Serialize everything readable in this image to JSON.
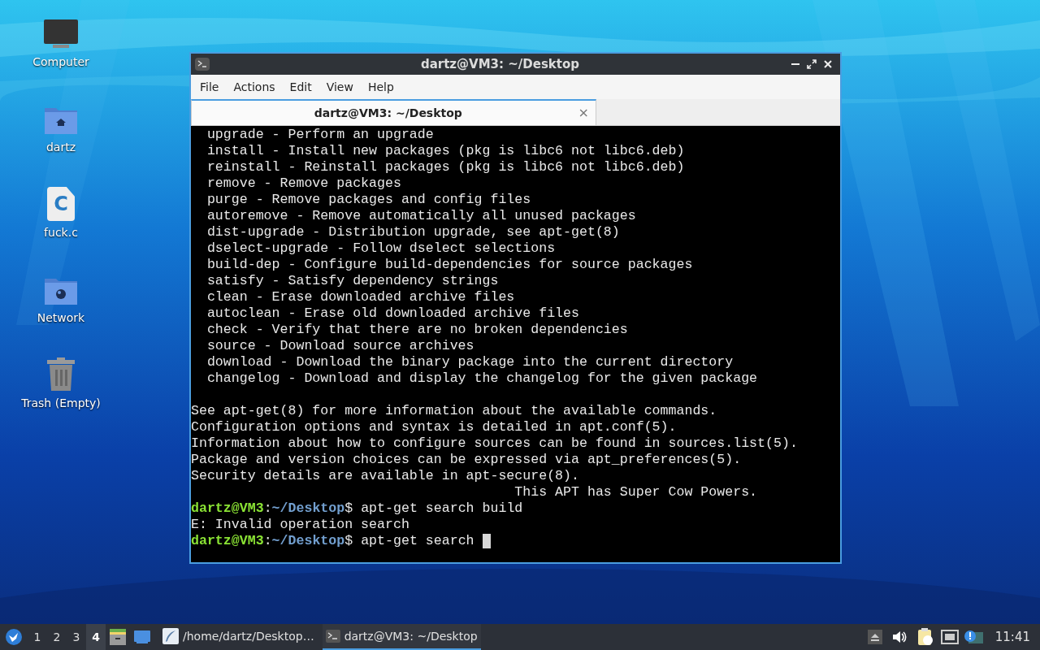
{
  "desktop_icons": [
    {
      "kind": "computer",
      "label": "Computer"
    },
    {
      "kind": "home",
      "label": "dartz"
    },
    {
      "kind": "cfile",
      "label": "fuck.c",
      "letter": "C"
    },
    {
      "kind": "network",
      "label": "Network"
    },
    {
      "kind": "trash",
      "label": "Trash (Empty)"
    }
  ],
  "window": {
    "title": "dartz@VM3: ~/Desktop",
    "menu": [
      "File",
      "Actions",
      "Edit",
      "View",
      "Help"
    ],
    "tabs": [
      {
        "label": "dartz@VM3: ~/Desktop",
        "selected": true,
        "close": "×"
      }
    ]
  },
  "terminal": {
    "lines": [
      {
        "kind": "text",
        "text": "  upgrade - Perform an upgrade"
      },
      {
        "kind": "text",
        "text": "  install - Install new packages (pkg is libc6 not libc6.deb)"
      },
      {
        "kind": "text",
        "text": "  reinstall - Reinstall packages (pkg is libc6 not libc6.deb)"
      },
      {
        "kind": "text",
        "text": "  remove - Remove packages"
      },
      {
        "kind": "text",
        "text": "  purge - Remove packages and config files"
      },
      {
        "kind": "text",
        "text": "  autoremove - Remove automatically all unused packages"
      },
      {
        "kind": "text",
        "text": "  dist-upgrade - Distribution upgrade, see apt-get(8)"
      },
      {
        "kind": "text",
        "text": "  dselect-upgrade - Follow dselect selections"
      },
      {
        "kind": "text",
        "text": "  build-dep - Configure build-dependencies for source packages"
      },
      {
        "kind": "text",
        "text": "  satisfy - Satisfy dependency strings"
      },
      {
        "kind": "text",
        "text": "  clean - Erase downloaded archive files"
      },
      {
        "kind": "text",
        "text": "  autoclean - Erase old downloaded archive files"
      },
      {
        "kind": "text",
        "text": "  check - Verify that there are no broken dependencies"
      },
      {
        "kind": "text",
        "text": "  source - Download source archives"
      },
      {
        "kind": "text",
        "text": "  download - Download the binary package into the current directory"
      },
      {
        "kind": "text",
        "text": "  changelog - Download and display the changelog for the given package"
      },
      {
        "kind": "blank"
      },
      {
        "kind": "text",
        "text": "See apt-get(8) for more information about the available commands."
      },
      {
        "kind": "text",
        "text": "Configuration options and syntax is detailed in apt.conf(5)."
      },
      {
        "kind": "text",
        "text": "Information about how to configure sources can be found in sources.list(5)."
      },
      {
        "kind": "text",
        "text": "Package and version choices can be expressed via apt_preferences(5)."
      },
      {
        "kind": "text",
        "text": "Security details are available in apt-secure(8)."
      },
      {
        "kind": "text",
        "text": "                                        This APT has Super Cow Powers."
      },
      {
        "kind": "prompt",
        "user_host": "dartz@VM3",
        "sep": ":",
        "path": "~/Desktop",
        "command": "$ apt-get search build",
        "cursor": false
      },
      {
        "kind": "text",
        "text": "E: Invalid operation search"
      },
      {
        "kind": "prompt",
        "user_host": "dartz@VM3",
        "sep": ":",
        "path": "~/Desktop",
        "command": "$ apt-get search ",
        "cursor": true
      }
    ]
  },
  "taskbar": {
    "workspaces": [
      {
        "label": "1",
        "selected": false
      },
      {
        "label": "2",
        "selected": false
      },
      {
        "label": "3",
        "selected": false
      },
      {
        "label": "4",
        "selected": true
      }
    ],
    "tasks": [
      {
        "kind": "editor",
        "label": "/home/dartz/Desktop…",
        "selected": false
      },
      {
        "kind": "terminal",
        "label": "dartz@VM3: ~/Desktop",
        "selected": true
      }
    ],
    "clock": "11:41"
  }
}
